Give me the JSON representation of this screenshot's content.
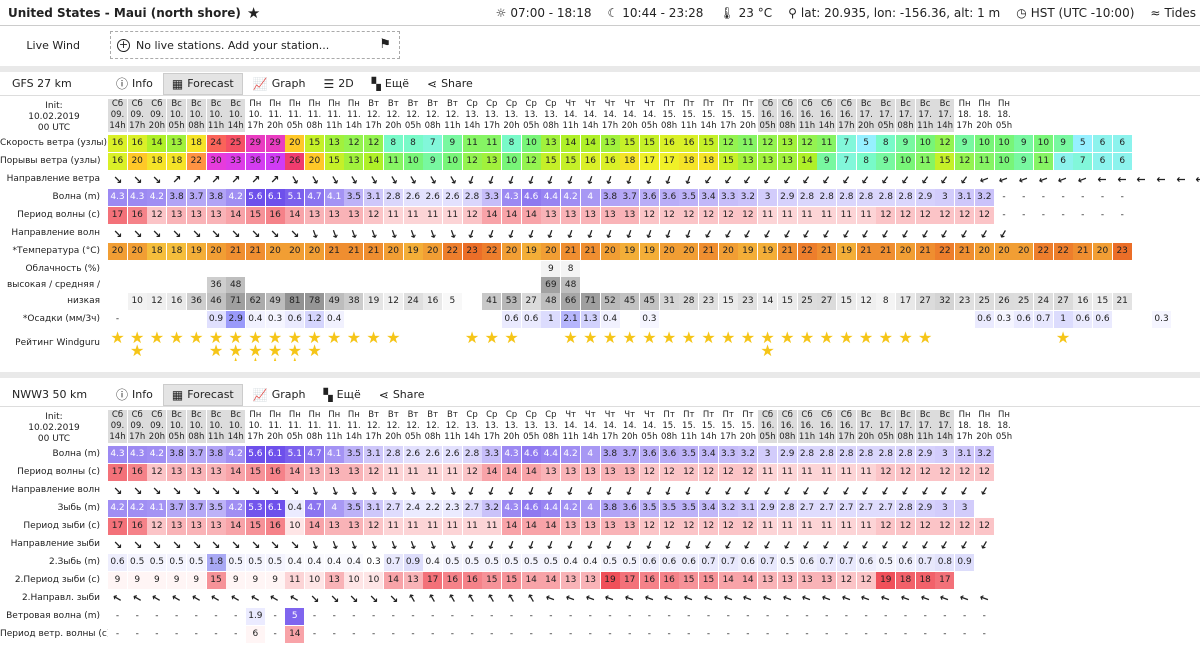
{
  "header": {
    "location": "United States - Maui (north shore)",
    "sun": "07:00 - 18:18",
    "moon": "10:44 - 23:28",
    "temp": "23 °C",
    "coords": "lat: 20.935, lon: -156.36, alt: 1 m",
    "tz": "HST (UTC -10:00)",
    "tides": "Tides"
  },
  "live": {
    "label": "Live Wind",
    "text": "No live stations. Add your station..."
  },
  "tabs": {
    "info": "Info",
    "forecast": "Forecast",
    "graph": "Graph",
    "twod": "2D",
    "more": "Ещё",
    "share": "Share"
  },
  "colors": {
    "wave": "#8a78e6",
    "period": "#f3a6a6",
    "temp": "#f0a033",
    "star": "#f5c518"
  },
  "gfs": {
    "name": "GFS 27 km",
    "init": [
      "Init:",
      "10.02.2019",
      "00 UTC"
    ],
    "days": [
      "Сб",
      "Сб",
      "Сб",
      "Вс",
      "Вс",
      "Вс",
      "Вс",
      "Пн",
      "Пн",
      "Пн",
      "Пн",
      "Пн",
      "Пн",
      "Вт",
      "Вт",
      "Вт",
      "Вт",
      "Вт",
      "Ср",
      "Ср",
      "Ср",
      "Ср",
      "Ср",
      "Чт",
      "Чт",
      "Чт",
      "Чт",
      "Чт",
      "Пт",
      "Пт",
      "Пт",
      "Пт",
      "Пт",
      "Сб",
      "Сб",
      "Сб",
      "Сб",
      "Сб",
      "Вс",
      "Вс",
      "Вс",
      "Вс",
      "Вс",
      "Пн",
      "Пн",
      "Пн",
      "Пн",
      "Пн",
      "Пн",
      "Пн",
      "Пн",
      "Пн",
      "Пн",
      "Пн",
      "Пн",
      "Пн",
      "Пн",
      "Пн"
    ],
    "dates": [
      "09.",
      "09.",
      "09.",
      "10.",
      "10.",
      "10.",
      "10.",
      "10.",
      "11.",
      "11.",
      "11.",
      "11.",
      "11.",
      "12.",
      "12.",
      "12.",
      "12.",
      "12.",
      "13.",
      "13.",
      "13.",
      "13.",
      "13.",
      "14.",
      "14.",
      "14.",
      "14.",
      "14.",
      "15.",
      "15.",
      "15.",
      "15.",
      "15.",
      "16.",
      "16.",
      "16.",
      "16.",
      "16.",
      "17.",
      "17.",
      "17.",
      "17.",
      "17.",
      "18.",
      "18.",
      "18."
    ],
    "hours": [
      "14h",
      "17h",
      "20h",
      "05h",
      "08h",
      "11h",
      "14h",
      "17h",
      "20h",
      "05h",
      "08h",
      "11h",
      "14h",
      "17h",
      "20h",
      "05h",
      "08h",
      "11h",
      "14h",
      "17h",
      "20h",
      "05h",
      "08h",
      "11h",
      "14h",
      "17h",
      "20h",
      "05h",
      "08h",
      "11h",
      "14h",
      "17h",
      "20h",
      "05h",
      "08h",
      "11h",
      "14h",
      "17h",
      "20h",
      "05h",
      "08h",
      "11h",
      "14h",
      "17h",
      "20h",
      "05h",
      "08h",
      "11h"
    ],
    "rows": {
      "wind": {
        "label": "Скорость ветра (узлы)",
        "values": [
          "16",
          "16",
          "14",
          "13",
          "18",
          "24",
          "25",
          "29",
          "29",
          "20",
          "15",
          "13",
          "12",
          "12",
          "8",
          "8",
          "7",
          "9",
          "11",
          "11",
          "8",
          "10",
          "13",
          "14",
          "14",
          "13",
          "15",
          "15",
          "16",
          "16",
          "15",
          "12",
          "11",
          "12",
          "13",
          "12",
          "11",
          "7",
          "5",
          "8",
          "9",
          "10",
          "12",
          "9",
          "10",
          "10",
          "9",
          "10",
          "9",
          "5",
          "6",
          "6"
        ]
      },
      "gust": {
        "label": "Порывы ветра (узлы)",
        "values": [
          "16",
          "20",
          "18",
          "18",
          "22",
          "30",
          "33",
          "36",
          "37",
          "26",
          "20",
          "15",
          "13",
          "14",
          "11",
          "10",
          "9",
          "10",
          "12",
          "13",
          "10",
          "12",
          "15",
          "15",
          "16",
          "16",
          "18",
          "17",
          "17",
          "18",
          "18",
          "15",
          "13",
          "13",
          "13",
          "14",
          "9",
          "7",
          "8",
          "9",
          "10",
          "11",
          "15",
          "12",
          "11",
          "10",
          "9",
          "11",
          "6",
          "7",
          "6",
          "6"
        ]
      },
      "winddir": {
        "label": "Направление ветра"
      },
      "wave": {
        "label": "Волна (m)",
        "values": [
          "4.3",
          "4.3",
          "4.2",
          "3.8",
          "3.7",
          "3.8",
          "4.2",
          "5.6",
          "6.1",
          "5.1",
          "4.7",
          "4.1",
          "3.5",
          "3.1",
          "2.8",
          "2.6",
          "2.6",
          "2.6",
          "2.8",
          "3.3",
          "4.3",
          "4.6",
          "4.4",
          "4.2",
          "4",
          "3.8",
          "3.7",
          "3.6",
          "3.6",
          "3.5",
          "3.4",
          "3.3",
          "3.2",
          "3",
          "2.9",
          "2.8",
          "2.8",
          "2.8",
          "2.8",
          "2.8",
          "2.8",
          "2.9",
          "3",
          "3.1",
          "3.2",
          "-",
          "-",
          "-",
          "-",
          "-",
          "-",
          "-"
        ]
      },
      "period": {
        "label": "Период волны (с)",
        "values": [
          "17",
          "16",
          "12",
          "13",
          "13",
          "13",
          "14",
          "15",
          "16",
          "14",
          "13",
          "13",
          "13",
          "12",
          "11",
          "11",
          "11",
          "11",
          "12",
          "14",
          "14",
          "14",
          "13",
          "13",
          "13",
          "13",
          "13",
          "12",
          "12",
          "12",
          "12",
          "12",
          "12",
          "11",
          "11",
          "11",
          "11",
          "11",
          "11",
          "12",
          "12",
          "12",
          "12",
          "12",
          "12",
          "-",
          "-",
          "-",
          "-",
          "-",
          "-",
          "-"
        ]
      },
      "wavedir": {
        "label": "Направление волн"
      },
      "temp": {
        "label": "*Температура (°C)",
        "values": [
          "20",
          "20",
          "18",
          "18",
          "19",
          "20",
          "21",
          "21",
          "20",
          "20",
          "20",
          "21",
          "21",
          "21",
          "20",
          "19",
          "20",
          "22",
          "23",
          "22",
          "20",
          "19",
          "20",
          "21",
          "21",
          "20",
          "19",
          "19",
          "20",
          "20",
          "21",
          "20",
          "19",
          "19",
          "21",
          "22",
          "21",
          "19",
          "21",
          "21",
          "20",
          "21",
          "22",
          "21",
          "20",
          "20",
          "20",
          "22",
          "22",
          "21",
          "20",
          "23"
        ]
      },
      "cloudlabel": "Облачность (%)",
      "cloudlabel2": "высокая / средняя /",
      "cloudlabel3": "низкая",
      "cloudhigh": {
        "values": [
          "",
          "",
          "",
          "",
          "",
          "",
          "",
          "",
          "",
          "",
          "",
          "",
          "",
          "",
          "",
          "",
          "",
          "",
          "",
          "",
          "",
          "",
          "9",
          "8",
          "",
          "",
          "",
          "",
          "",
          "",
          "",
          "",
          "",
          "",
          "",
          "",
          "",
          "",
          "",
          "",
          "",
          "",
          "",
          "",
          "",
          "",
          "",
          "",
          "",
          "",
          ""
        ]
      },
      "cloudmid": {
        "values": [
          "",
          "",
          "",
          "",
          "",
          "36",
          "48",
          "",
          "",
          "",
          "",
          "",
          "",
          "",
          "",
          "",
          "",
          "",
          "",
          "",
          "",
          "",
          "69",
          "48",
          "",
          "",
          "",
          "",
          "",
          "",
          "",
          "",
          "",
          "",
          "",
          "",
          "",
          "",
          "",
          "",
          "",
          "",
          "",
          "",
          "",
          "",
          "",
          "",
          "",
          "",
          ""
        ]
      },
      "cloudlow": {
        "values": [
          "",
          "10",
          "12",
          "16",
          "36",
          "46",
          "71",
          "62",
          "49",
          "81",
          "78",
          "49",
          "38",
          "19",
          "12",
          "24",
          "16",
          "5",
          "",
          "41",
          "53",
          "27",
          "48",
          "66",
          "71",
          "52",
          "45",
          "45",
          "31",
          "28",
          "23",
          "15",
          "23",
          "14",
          "15",
          "25",
          "27",
          "15",
          "12",
          "8",
          "17",
          "27",
          "32",
          "23",
          "25",
          "26",
          "25",
          "24",
          "27",
          "16",
          "15",
          "21"
        ]
      },
      "rain": {
        "label": "*Осадки (мм/3ч)",
        "values": [
          "-",
          "",
          "",
          "",
          "",
          "0.9",
          "2.9",
          "0.4",
          "0.3",
          "0.6",
          "1.2",
          "0.4",
          "",
          "",
          "",
          "",
          "",
          "",
          "",
          "",
          "0.6",
          "0.6",
          "1",
          "2.1",
          "1.3",
          "0.4",
          "",
          "0.3",
          "",
          "",
          "",
          "",
          "",
          "",
          "",
          "",
          "",
          "",
          "",
          "",
          "",
          "",
          "",
          "",
          "0.6",
          "0.3",
          "0.6",
          "0.7",
          "1",
          "0.6",
          "0.6",
          "",
          "",
          "0.3"
        ]
      },
      "rating": {
        "label": "Рейтинг Windguru"
      }
    }
  },
  "nww3": {
    "name": "NWW3 50 km",
    "init": [
      "Init:",
      "10.02.2019",
      "00 UTC"
    ],
    "rows": {
      "wave": {
        "label": "Волна (m)",
        "values": [
          "4.3",
          "4.3",
          "4.2",
          "3.8",
          "3.7",
          "3.8",
          "4.2",
          "5.6",
          "6.1",
          "5.1",
          "4.7",
          "4.1",
          "3.5",
          "3.1",
          "2.8",
          "2.6",
          "2.6",
          "2.6",
          "2.8",
          "3.3",
          "4.3",
          "4.6",
          "4.4",
          "4.2",
          "4",
          "3.8",
          "3.7",
          "3.6",
          "3.6",
          "3.5",
          "3.4",
          "3.3",
          "3.2",
          "3",
          "2.9",
          "2.8",
          "2.8",
          "2.8",
          "2.8",
          "2.8",
          "2.8",
          "2.9",
          "3",
          "3.1",
          "3.2"
        ]
      },
      "period": {
        "label": "Период волны (с)",
        "values": [
          "17",
          "16",
          "12",
          "13",
          "13",
          "13",
          "14",
          "15",
          "16",
          "14",
          "13",
          "13",
          "13",
          "12",
          "11",
          "11",
          "11",
          "11",
          "12",
          "14",
          "14",
          "14",
          "13",
          "13",
          "13",
          "13",
          "13",
          "12",
          "12",
          "12",
          "12",
          "12",
          "12",
          "11",
          "11",
          "11",
          "11",
          "11",
          "11",
          "12",
          "12",
          "12",
          "12",
          "12",
          "12"
        ]
      },
      "wavedir": {
        "label": "Направление волн"
      },
      "swell": {
        "label": "Зыбь (m)",
        "values": [
          "4.2",
          "4.2",
          "4.1",
          "3.7",
          "3.7",
          "3.5",
          "4.2",
          "5.3",
          "6.1",
          "0.4",
          "4.7",
          "4",
          "3.5",
          "3.1",
          "2.7",
          "2.4",
          "2.2",
          "2.3",
          "2.7",
          "3.2",
          "4.3",
          "4.6",
          "4.4",
          "4.2",
          "4",
          "3.8",
          "3.6",
          "3.5",
          "3.5",
          "3.5",
          "3.4",
          "3.2",
          "3.1",
          "2.9",
          "2.8",
          "2.7",
          "2.7",
          "2.7",
          "2.7",
          "2.7",
          "2.8",
          "2.9",
          "3",
          "3"
        ]
      },
      "swellper": {
        "label": "Период зыби (с)",
        "values": [
          "17",
          "16",
          "12",
          "13",
          "13",
          "13",
          "14",
          "15",
          "16",
          "10",
          "14",
          "13",
          "13",
          "12",
          "11",
          "11",
          "11",
          "11",
          "11",
          "11",
          "14",
          "14",
          "14",
          "13",
          "13",
          "13",
          "13",
          "12",
          "12",
          "12",
          "12",
          "12",
          "12",
          "11",
          "11",
          "11",
          "11",
          "11",
          "11",
          "12",
          "12",
          "12",
          "12",
          "12",
          "12"
        ]
      },
      "swelldir": {
        "label": "Направление зыби"
      },
      "swell2": {
        "label": "2.Зыбь (m)",
        "values": [
          "0.6",
          "0.5",
          "0.5",
          "0.5",
          "0.5",
          "1.8",
          "0.5",
          "0.5",
          "0.5",
          "0.4",
          "0.4",
          "0.4",
          "0.4",
          "0.3",
          "0.7",
          "0.9",
          "0.4",
          "0.5",
          "0.5",
          "0.5",
          "0.5",
          "0.5",
          "0.5",
          "0.4",
          "0.4",
          "0.5",
          "0.5",
          "0.6",
          "0.6",
          "0.6",
          "0.7",
          "0.7",
          "0.6",
          "0.7",
          "0.5",
          "0.6",
          "0.7",
          "0.7",
          "0.6",
          "0.5",
          "0.6",
          "0.7",
          "0.8",
          "0.9"
        ]
      },
      "swell2per": {
        "label": "2.Период зыби (с)",
        "values": [
          "9",
          "9",
          "9",
          "9",
          "9",
          "15",
          "9",
          "9",
          "9",
          "11",
          "10",
          "13",
          "10",
          "10",
          "14",
          "13",
          "17",
          "16",
          "16",
          "15",
          "15",
          "14",
          "14",
          "13",
          "13",
          "19",
          "17",
          "16",
          "16",
          "15",
          "15",
          "14",
          "14",
          "13",
          "13",
          "13",
          "13",
          "12",
          "12",
          "19",
          "18",
          "18",
          "17"
        ]
      },
      "swell2dir": {
        "label": "2.Направл. зыби"
      },
      "windwave": {
        "label": "Ветровая волна (m)",
        "values": [
          "-",
          "-",
          "-",
          "-",
          "-",
          "-",
          "-",
          "1.9",
          "-",
          "5",
          "-",
          "-",
          "-",
          "-",
          "-",
          "-",
          "-",
          "-",
          "-",
          "-",
          "-",
          "-",
          "-",
          "-",
          "-",
          "-",
          "-",
          "-",
          "-",
          "-",
          "-",
          "-",
          "-",
          "-",
          "-",
          "-",
          "-",
          "-",
          "-",
          "-",
          "-",
          "-",
          "-",
          "-",
          "-"
        ]
      },
      "windwaveper": {
        "label": "Период ветр. волны (с)",
        "values": [
          "-",
          "-",
          "-",
          "-",
          "-",
          "-",
          "-",
          "6",
          "-",
          "14",
          "-",
          "-",
          "-",
          "-",
          "-",
          "-",
          "-",
          "-",
          "-",
          "-",
          "-",
          "-",
          "-",
          "-",
          "-",
          "-",
          "-",
          "-",
          "-",
          "-",
          "-",
          "-",
          "-",
          "-",
          "-",
          "-",
          "-",
          "-",
          "-",
          "-",
          "-",
          "-",
          "-",
          "-",
          "-"
        ]
      }
    }
  }
}
